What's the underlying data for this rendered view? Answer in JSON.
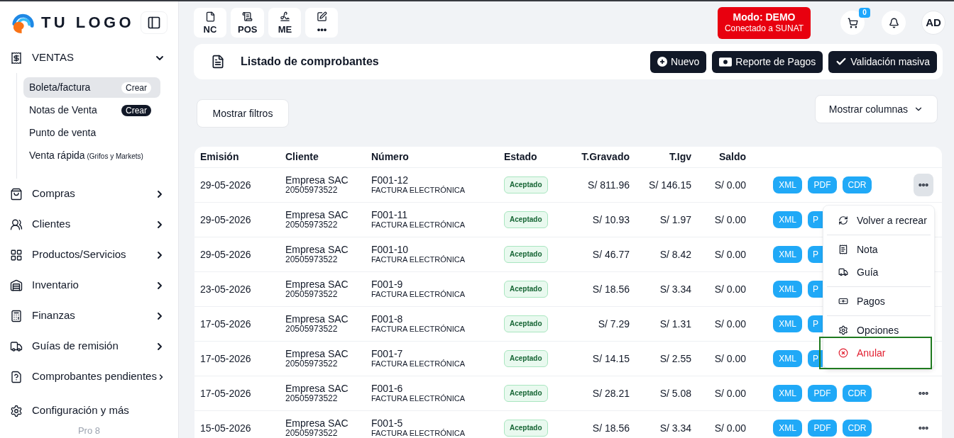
{
  "top_bar": {
    "shortcuts": [
      {
        "label": "NC"
      },
      {
        "label": "POS"
      },
      {
        "label": "ME"
      },
      {
        "label": "•••"
      }
    ],
    "mode": {
      "title": "Modo: DEMO",
      "subtitle": "Conectado a SUNAT"
    },
    "cart_count": "0",
    "avatar": "AD"
  },
  "sidebar": {
    "logo": "TU LOGO",
    "sections": [
      {
        "kind": "group",
        "label": "VENTAS",
        "expanded": true,
        "children": [
          {
            "label": "Boleta/factura",
            "badge": "Crear",
            "selected": true
          },
          {
            "label": "Notas de Venta",
            "badge": "Crear",
            "selected": false
          },
          {
            "label": "Punto de venta",
            "selected": false
          },
          {
            "label": "Venta rápida",
            "note": "(Grifos y Markets)",
            "selected": false
          }
        ]
      },
      {
        "kind": "group",
        "label": "Compras",
        "expanded": false
      },
      {
        "kind": "group",
        "label": "Clientes",
        "expanded": false
      },
      {
        "kind": "group",
        "label": "Productos/Servicios",
        "expanded": false
      },
      {
        "kind": "group",
        "label": "Inventario",
        "expanded": false
      },
      {
        "kind": "group",
        "label": "Finanzas",
        "expanded": false
      },
      {
        "kind": "group",
        "label": "Guías de remisión",
        "expanded": false
      },
      {
        "kind": "group",
        "label": "Comprobantes pendientes",
        "expanded": false
      },
      {
        "kind": "link",
        "label": "Configuración y más"
      }
    ],
    "version": "Pro 8"
  },
  "header": {
    "title": "Listado de comprobantes",
    "actions": [
      "Nuevo",
      "Reporte de Pagos",
      "Validación masiva"
    ]
  },
  "filters_button": "Mostrar filtros",
  "columns_button": "Mostrar columnas",
  "table": {
    "columns": [
      "Emisión",
      "Cliente",
      "Número",
      "Estado",
      "T.Gravado",
      "T.Igv",
      "Saldo"
    ],
    "rows": [
      {
        "date": "29-05-2026",
        "client": "Empresa SAC",
        "ruc": "20505973522",
        "number": "F001-12",
        "doc_type": "FACTURA ELECTRÓNICA",
        "status": {
          "label": "Aceptado",
          "kind": "accepted"
        },
        "gravado": "S/ 811.96",
        "igv": "S/ 146.15",
        "saldo": "S/ 0.00",
        "actions": [
          {
            "label": "XML",
            "clipped": false
          },
          {
            "label": "PDF",
            "clipped": false
          },
          {
            "label": "CDR",
            "clipped": false
          }
        ],
        "more_button": {
          "active": true
        }
      },
      {
        "date": "29-05-2026",
        "client": "Empresa SAC",
        "ruc": "20505973522",
        "number": "F001-11",
        "doc_type": "FACTURA ELECTRÓNICA",
        "status": {
          "label": "Aceptado",
          "kind": "accepted"
        },
        "gravado": "S/ 10.93",
        "igv": "S/ 1.97",
        "saldo": "S/ 0.00",
        "actions": [
          {
            "label": "XML",
            "clipped": false
          },
          {
            "label": "P",
            "clipped": true
          }
        ]
      },
      {
        "date": "29-05-2026",
        "client": "Empresa SAC",
        "ruc": "20505973522",
        "number": "F001-10",
        "doc_type": "FACTURA ELECTRÓNICA",
        "status": {
          "label": "Aceptado",
          "kind": "accepted"
        },
        "gravado": "S/ 46.77",
        "igv": "S/ 8.42",
        "saldo": "S/ 0.00",
        "actions": [
          {
            "label": "XML",
            "clipped": false
          },
          {
            "label": "P",
            "clipped": true
          }
        ]
      },
      {
        "date": "23-05-2026",
        "client": "Empresa SAC",
        "ruc": "20505973522",
        "number": "F001-9",
        "doc_type": "FACTURA ELECTRÓNICA",
        "status": {
          "label": "Aceptado",
          "kind": "accepted"
        },
        "gravado": "S/ 18.56",
        "igv": "S/ 3.34",
        "saldo": "S/ 0.00",
        "actions": [
          {
            "label": "XML",
            "clipped": false
          },
          {
            "label": "P",
            "clipped": true
          }
        ]
      },
      {
        "date": "17-05-2026",
        "client": "Empresa SAC",
        "ruc": "20505973522",
        "number": "F001-8",
        "doc_type": "FACTURA ELECTRÓNICA",
        "status": {
          "label": "Aceptado",
          "kind": "accepted"
        },
        "gravado": "S/ 7.29",
        "igv": "S/ 1.31",
        "saldo": "S/ 0.00",
        "actions": [
          {
            "label": "XML",
            "clipped": false
          },
          {
            "label": "P",
            "clipped": true
          }
        ]
      },
      {
        "date": "17-05-2026",
        "client": "Empresa SAC",
        "ruc": "20505973522",
        "number": "F001-7",
        "doc_type": "FACTURA ELECTRÓNICA",
        "status": {
          "label": "Aceptado",
          "kind": "accepted"
        },
        "gravado": "S/ 14.15",
        "igv": "S/ 2.55",
        "saldo": "S/ 0.00",
        "actions": [
          {
            "label": "XML",
            "clipped": false
          },
          {
            "label": "P",
            "clipped": true
          }
        ]
      },
      {
        "date": "17-05-2026",
        "client": "Empresa SAC",
        "ruc": "20505973522",
        "number": "F001-6",
        "doc_type": "FACTURA ELECTRÓNICA",
        "status": {
          "label": "Aceptado",
          "kind": "accepted"
        },
        "gravado": "S/ 28.21",
        "igv": "S/ 5.08",
        "saldo": "S/ 0.00",
        "actions": [
          {
            "label": "XML",
            "clipped": false
          },
          {
            "label": "PDF",
            "clipped": false
          },
          {
            "label": "CDR",
            "clipped": false
          }
        ],
        "more_button": {
          "active": false
        }
      },
      {
        "date": "15-05-2026",
        "client": "Empresa SAC",
        "ruc": "20505973522",
        "number": "F001-5",
        "doc_type": "FACTURA ELECTRÓNICA",
        "status": {
          "label": "Aceptado",
          "kind": "accepted"
        },
        "gravado": "S/ 18.56",
        "igv": "S/ 3.34",
        "saldo": "S/ 0.00",
        "actions": [
          {
            "label": "XML",
            "clipped": false
          },
          {
            "label": "PDF",
            "clipped": false
          },
          {
            "label": "CDR",
            "clipped": false
          }
        ],
        "more_button": {
          "active": false
        }
      }
    ]
  },
  "row_menu": {
    "groups": [
      [
        {
          "label": "Volver a recrear",
          "kind": "normal",
          "highlighted": false
        }
      ],
      [
        {
          "label": "Nota",
          "kind": "normal",
          "highlighted": false
        },
        {
          "label": "Guía",
          "kind": "normal",
          "highlighted": false
        }
      ],
      [
        {
          "label": "Pagos",
          "kind": "normal",
          "highlighted": false
        }
      ],
      [
        {
          "label": "Opciones",
          "kind": "normal",
          "highlighted": false
        },
        {
          "label": "Anular",
          "kind": "danger",
          "highlighted": true
        }
      ]
    ]
  }
}
